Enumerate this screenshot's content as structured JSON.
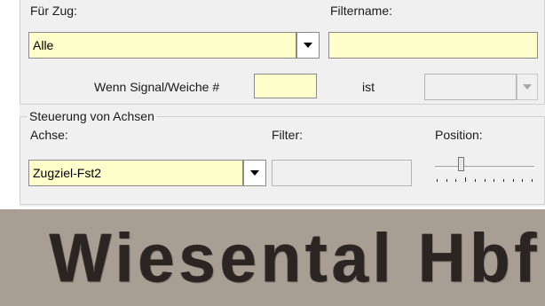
{
  "train_filter": {
    "for_train_label": "Für Zug:",
    "for_train_value": "Alle",
    "filter_name_label": "Filtername:",
    "filter_name_value": "",
    "signal_condition_label": "Wenn Signal/Weiche #",
    "signal_number_value": "",
    "is_label": "ist",
    "state_value": ""
  },
  "axis_control": {
    "group_title": "Steuerung von Achsen",
    "axis_label": "Achse:",
    "axis_value": "Zugziel-Fst2",
    "filter_label": "Filter:",
    "filter_value": "",
    "position_label": "Position:",
    "position_level": 0.25
  },
  "banner": {
    "text": "Wiesental Hbf"
  },
  "colors": {
    "field_bg": "#ffffcc",
    "panel_bg": "#f0f0f0",
    "banner_bg": "#a89e93",
    "banner_text": "#2a2522"
  }
}
